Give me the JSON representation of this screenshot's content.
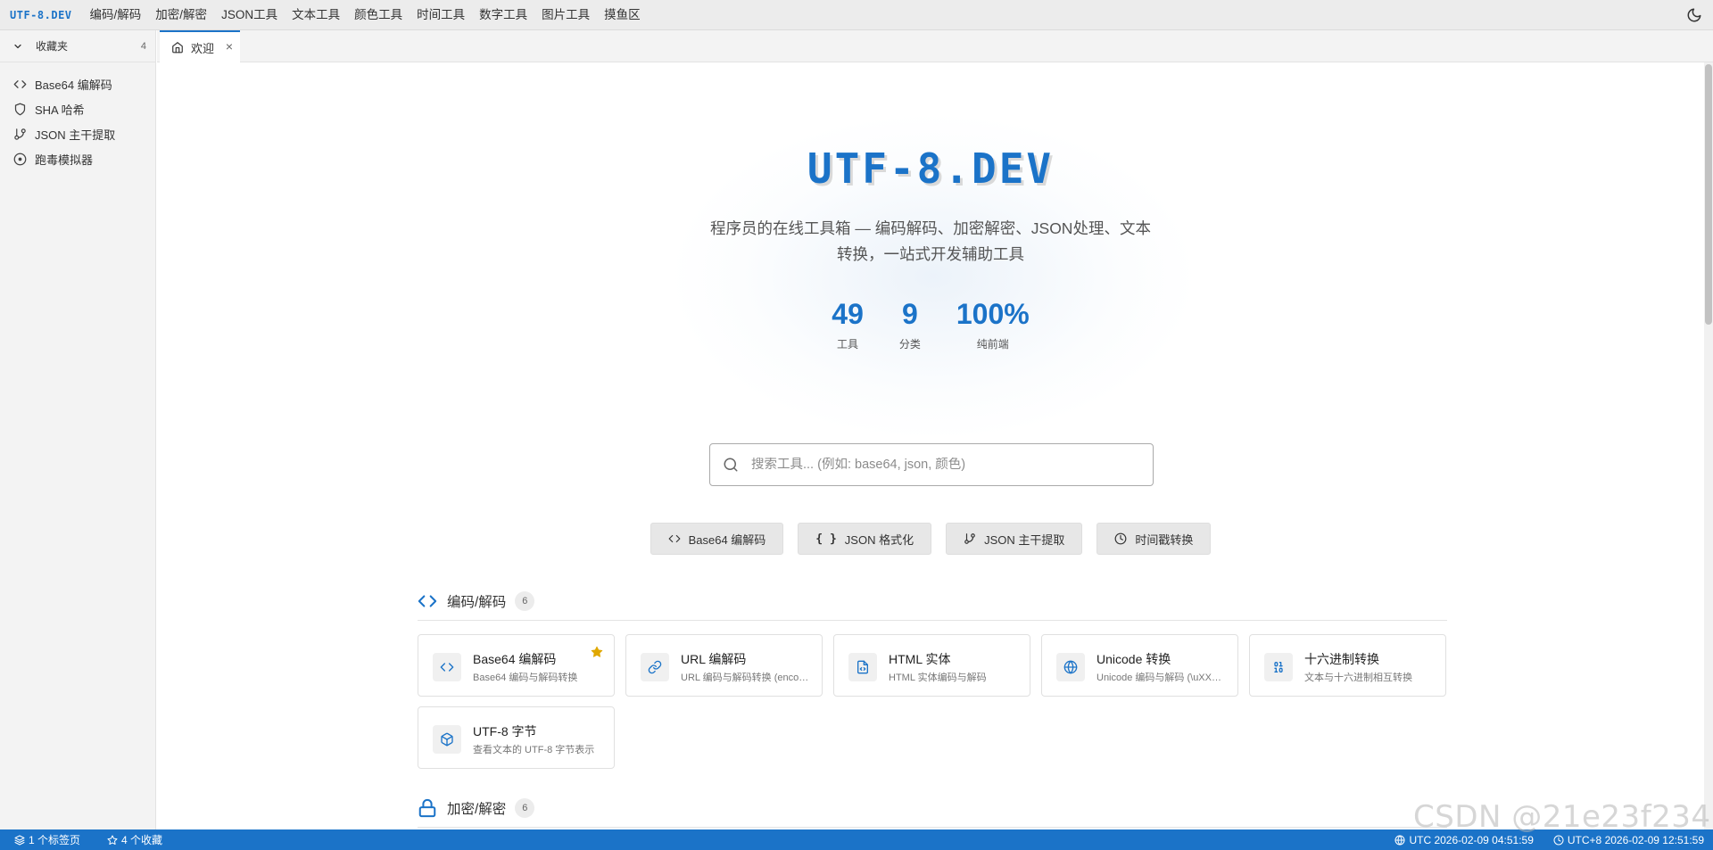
{
  "menubar": {
    "brand": "UTF-8.DEV",
    "items": [
      "编码/解码",
      "加密/解密",
      "JSON工具",
      "文本工具",
      "颜色工具",
      "时间工具",
      "数字工具",
      "图片工具",
      "摸鱼区"
    ],
    "theme_icon": "moon-icon"
  },
  "sidebar": {
    "title": "收藏夹",
    "count": "4",
    "items": [
      {
        "label": "Base64 编解码",
        "icon": "code-icon"
      },
      {
        "label": "SHA 哈希",
        "icon": "shield-icon"
      },
      {
        "label": "JSON 主干提取",
        "icon": "git-branch-icon"
      },
      {
        "label": "跑毒模拟器",
        "icon": "target-icon"
      }
    ]
  },
  "tabs": [
    {
      "label": "欢迎",
      "icon": "home-icon",
      "close": "×"
    }
  ],
  "hero": {
    "title": "UTF-8.DEV",
    "subtitle": "程序员的在线工具箱 — 编码解码、加密解密、JSON处理、文本转换，一站式开发辅助工具",
    "stats": [
      {
        "value": "49",
        "label": "工具"
      },
      {
        "value": "9",
        "label": "分类"
      },
      {
        "value": "100%",
        "label": "纯前端"
      }
    ]
  },
  "search": {
    "placeholder": "搜索工具... (例如: base64, json, 颜色)"
  },
  "quick_actions": [
    {
      "label": "Base64 编解码",
      "icon": "code-icon"
    },
    {
      "label": "JSON 格式化",
      "icon": "braces-icon"
    },
    {
      "label": "JSON 主干提取",
      "icon": "git-branch-icon"
    },
    {
      "label": "时间戳转换",
      "icon": "clock-icon"
    }
  ],
  "sections": [
    {
      "title": "编码/解码",
      "count": "6",
      "icon": "code-icon",
      "tools": [
        {
          "name": "Base64 编解码",
          "desc": "Base64 编码与解码转换",
          "icon": "code-icon",
          "starred": true
        },
        {
          "name": "URL 编解码",
          "desc": "URL 编码与解码转换 (encodeURIComponent)",
          "icon": "link-icon",
          "starred": false
        },
        {
          "name": "HTML 实体",
          "desc": "HTML 实体编码与解码",
          "icon": "file-code-icon",
          "starred": false
        },
        {
          "name": "Unicode 转换",
          "desc": "Unicode 编码与解码 (\\uXXXX)",
          "icon": "globe-icon",
          "starred": false
        },
        {
          "name": "十六进制转换",
          "desc": "文本与十六进制相互转换",
          "icon": "binary-icon",
          "starred": false
        },
        {
          "name": "UTF-8 字节",
          "desc": "查看文本的 UTF-8 字节表示",
          "icon": "box-icon",
          "starred": false
        }
      ]
    },
    {
      "title": "加密/解密",
      "count": "6",
      "icon": "lock-icon"
    }
  ],
  "statusbar": {
    "tabs": "1 个标签页",
    "favorites": "4 个收藏",
    "utc": "UTC 2026-02-09 04:51:59",
    "local": "UTC+8 2026-02-09 12:51:59"
  },
  "watermark": "CSDN @21e23f234",
  "colors": {
    "accent": "#1b73c8",
    "star": "#e0a800"
  }
}
